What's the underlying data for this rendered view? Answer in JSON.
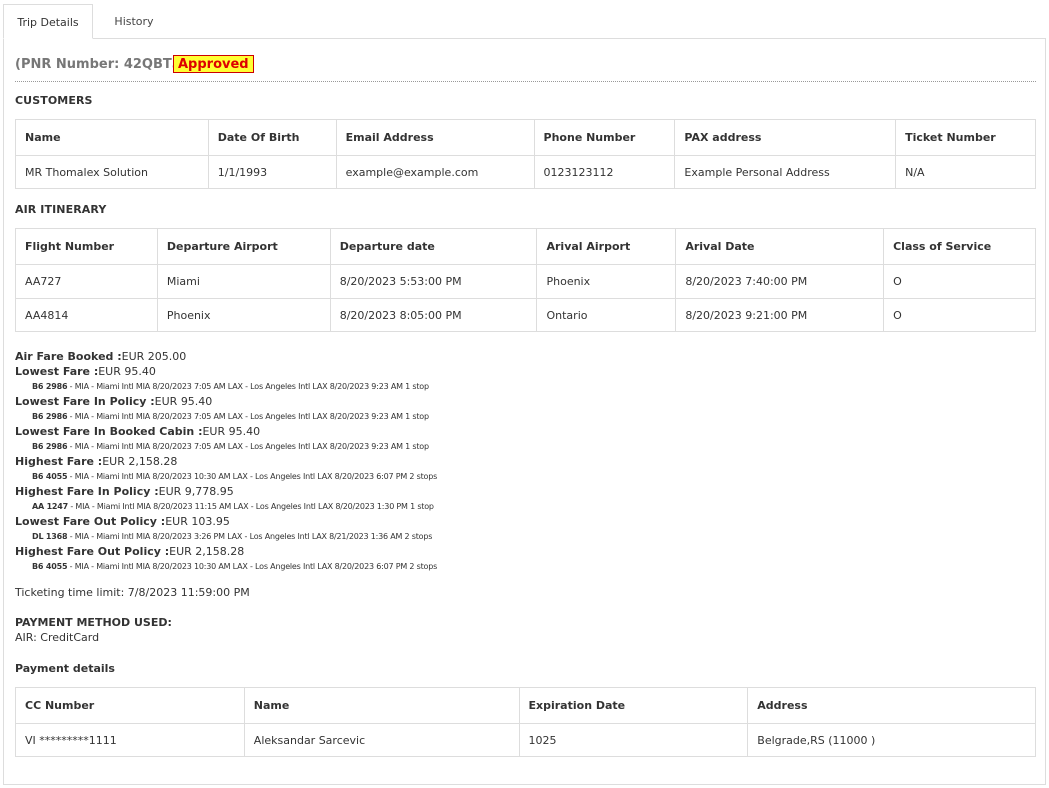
{
  "tabs": [
    {
      "label": "Trip Details",
      "active": true
    },
    {
      "label": "History",
      "active": false
    }
  ],
  "pnr": {
    "text": "(PNR Number: 42QBT5)",
    "status": "Approved"
  },
  "customers": {
    "title": "CUSTOMERS",
    "headers": [
      "Name",
      "Date Of Birth",
      "Email Address",
      "Phone Number",
      "PAX address",
      "Ticket Number"
    ],
    "rows": [
      [
        "MR Thomalex Solution",
        "1/1/1993",
        "example@example.com",
        "0123123112",
        "Example Personal Address",
        "N/A"
      ]
    ]
  },
  "itinerary": {
    "title": "AIR ITINERARY",
    "headers": [
      "Flight Number",
      "Departure Airport",
      "Departure date",
      "Arival Airport",
      "Arival Date",
      "Class of Service"
    ],
    "rows": [
      [
        "AA727",
        "Miami",
        "8/20/2023 5:53:00 PM",
        "Phoenix",
        "8/20/2023 7:40:00 PM",
        "O"
      ],
      [
        "AA4814",
        "Phoenix",
        "8/20/2023 8:05:00 PM",
        "Ontario",
        "8/20/2023 9:21:00 PM",
        "O"
      ]
    ]
  },
  "fares": [
    {
      "label": "Air Fare Booked :",
      "value": "EUR 205.00",
      "flight": "",
      "detail": ""
    },
    {
      "label": "Lowest Fare :",
      "value": "EUR 95.40",
      "flight": "B6 2986",
      "detail": " - MIA - Miami Intl MIA 8/20/2023 7:05 AM LAX - Los Angeles Intl LAX 8/20/2023 9:23 AM 1 stop"
    },
    {
      "label": "Lowest Fare In Policy :",
      "value": "EUR 95.40",
      "flight": "B6 2986",
      "detail": " - MIA - Miami Intl MIA 8/20/2023 7:05 AM LAX - Los Angeles Intl LAX 8/20/2023 9:23 AM 1 stop"
    },
    {
      "label": "Lowest Fare In Booked Cabin :",
      "value": "EUR 95.40",
      "flight": "B6 2986",
      "detail": " - MIA - Miami Intl MIA 8/20/2023 7:05 AM LAX - Los Angeles Intl LAX 8/20/2023 9:23 AM 1 stop"
    },
    {
      "label": "Highest Fare :",
      "value": "EUR 2,158.28",
      "flight": "B6 4055",
      "detail": " - MIA - Miami Intl MIA 8/20/2023 10:30 AM LAX - Los Angeles Intl LAX 8/20/2023 6:07 PM 2 stops"
    },
    {
      "label": "Highest Fare In Policy :",
      "value": "EUR 9,778.95",
      "flight": "AA 1247",
      "detail": " - MIA - Miami Intl MIA 8/20/2023 11:15 AM LAX - Los Angeles Intl LAX 8/20/2023 1:30 PM 1 stop"
    },
    {
      "label": "Lowest Fare Out Policy :",
      "value": "EUR 103.95",
      "flight": "DL 1368",
      "detail": " - MIA - Miami Intl MIA 8/20/2023 3:26 PM LAX - Los Angeles Intl LAX 8/21/2023 1:36 AM 2 stops"
    },
    {
      "label": "Highest Fare Out Policy :",
      "value": "EUR 2,158.28",
      "flight": "B6 4055",
      "detail": " - MIA - Miami Intl MIA 8/20/2023 10:30 AM LAX - Los Angeles Intl LAX 8/20/2023 6:07 PM 2 stops"
    }
  ],
  "ticketing": {
    "text": "Ticketing time limit: 7/8/2023 11:59:00 PM"
  },
  "payment_method": {
    "title": "PAYMENT METHOD USED:",
    "value": "AIR: CreditCard"
  },
  "payment_details": {
    "title": "Payment details",
    "headers": [
      "CC Number",
      "Name",
      "Expiration Date",
      "Address"
    ],
    "rows": [
      [
        "VI *********1111",
        "Aleksandar Sarcevic",
        "1025",
        "Belgrade,RS (11000 )"
      ]
    ]
  }
}
